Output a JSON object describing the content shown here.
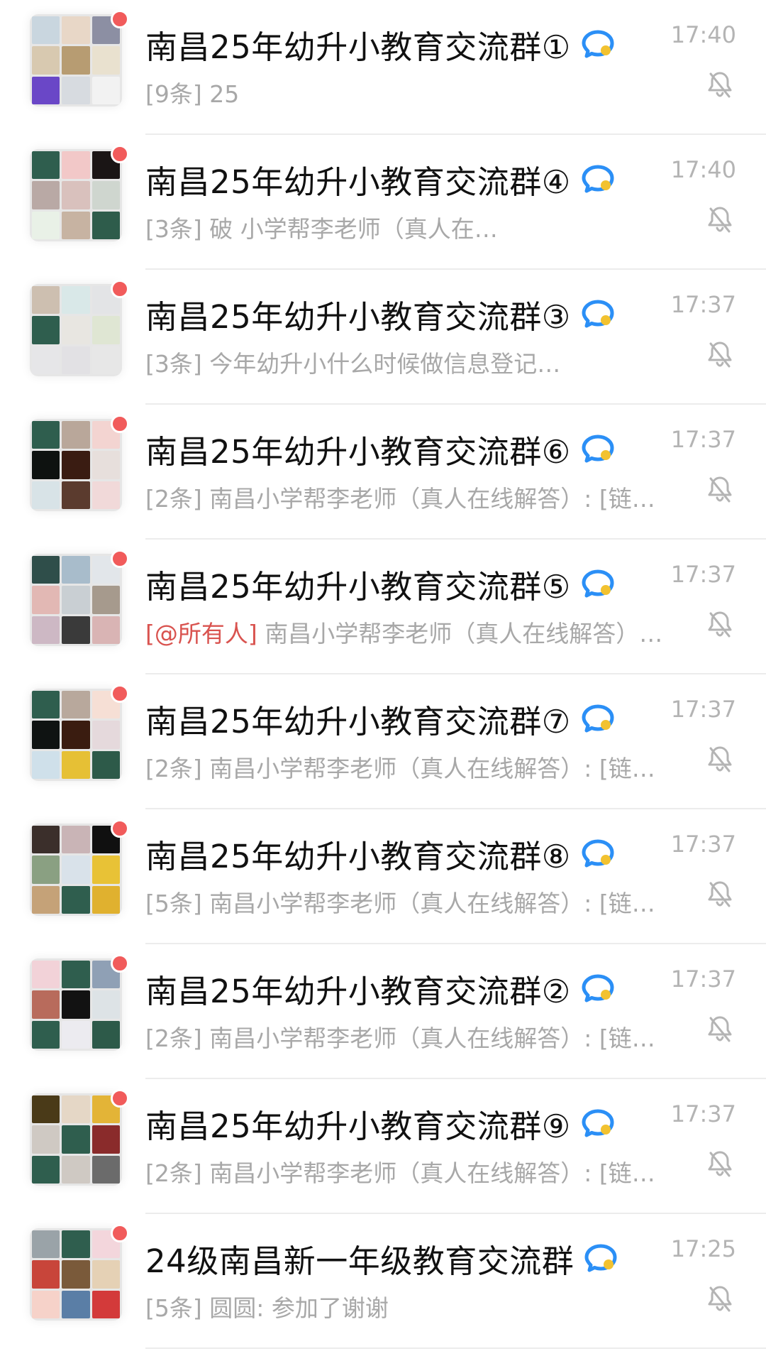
{
  "conversations": [
    {
      "title": "南昌25年幼升小教育交流群①",
      "preview_count": "[9条]",
      "preview_mention": "",
      "preview_text": "25",
      "time": "17:40",
      "muted": true,
      "unread_dot": true,
      "avatar_colors": [
        "#c9d6df",
        "#e8d7c7",
        "#8c8fa3",
        "#d8c9b0",
        "#b79c72",
        "#e9e1cf",
        "#6a47c7",
        "#d7dbe0",
        "#f2f2f2"
      ]
    },
    {
      "title": "南昌25年幼升小教育交流群④",
      "preview_count": "[3条]",
      "preview_mention": "",
      "preview_text": "破  小学帮李老师（真人在…",
      "time": "17:40",
      "muted": true,
      "unread_dot": true,
      "avatar_colors": [
        "#2f5e4e",
        "#f2c8c8",
        "#1a1515",
        "#b9a9a5",
        "#d9c1bd",
        "#cfd6cf",
        "#e9f1e7",
        "#c7b3a2",
        "#2e5c4b"
      ]
    },
    {
      "title": "南昌25年幼升小教育交流群③",
      "preview_count": "[3条]",
      "preview_mention": "",
      "preview_text": "今年幼升小什么时候做信息登记…",
      "time": "17:37",
      "muted": true,
      "unread_dot": true,
      "avatar_colors": [
        "#cdbfb0",
        "#d9e8e8",
        "#e3e4e6",
        "#2f5e4e",
        "#e8e6e1",
        "#dfe6d3",
        "#e6e6e8",
        "#e2e1e4",
        "#e7e7e7"
      ]
    },
    {
      "title": "南昌25年幼升小教育交流群⑥",
      "preview_count": "[2条]",
      "preview_mention": "",
      "preview_text": "南昌小学帮李老师（真人在线解答）: [链…",
      "time": "17:37",
      "muted": true,
      "unread_dot": true,
      "avatar_colors": [
        "#2f5e4e",
        "#b9a79a",
        "#f3d4d1",
        "#0e1210",
        "#3a1c12",
        "#e7dfdc",
        "#d8e3e7",
        "#5b3b2e",
        "#f1d9d9"
      ]
    },
    {
      "title": "南昌25年幼升小教育交流群⑤",
      "preview_count": "",
      "preview_mention": "[@所有人]",
      "preview_text": "南昌小学帮李老师（真人在线解答）…",
      "time": "17:37",
      "muted": true,
      "unread_dot": true,
      "avatar_colors": [
        "#2f4e4a",
        "#a8bccb",
        "#e2e6ea",
        "#e2b8b4",
        "#c9cfd3",
        "#a69a8d",
        "#cdb8c4",
        "#3a3a3a",
        "#d9b4b4"
      ]
    },
    {
      "title": "南昌25年幼升小教育交流群⑦",
      "preview_count": "[2条]",
      "preview_mention": "",
      "preview_text": "南昌小学帮李老师（真人在线解答）: [链…",
      "time": "17:37",
      "muted": true,
      "unread_dot": true,
      "avatar_colors": [
        "#2f5e4e",
        "#b8a89c",
        "#f6dfd5",
        "#0f1312",
        "#3a1c10",
        "#e5d9dc",
        "#cfe0ea",
        "#e6c035",
        "#2d5a49"
      ]
    },
    {
      "title": "南昌25年幼升小教育交流群⑧",
      "preview_count": "[5条]",
      "preview_mention": "",
      "preview_text": "南昌小学帮李老师（真人在线解答）: [链…",
      "time": "17:37",
      "muted": true,
      "unread_dot": true,
      "avatar_colors": [
        "#3b2f2b",
        "#c9b4b6",
        "#101010",
        "#8aa082",
        "#d9e2ea",
        "#e8c236",
        "#c5a278",
        "#2f5e4e",
        "#e0b12f"
      ]
    },
    {
      "title": "南昌25年幼升小教育交流群②",
      "preview_count": "[2条]",
      "preview_mention": "",
      "preview_text": "南昌小学帮李老师（真人在线解答）: [链…",
      "time": "17:37",
      "muted": true,
      "unread_dot": true,
      "avatar_colors": [
        "#f2d2d8",
        "#2f5e4e",
        "#8fa0b5",
        "#b86b5c",
        "#121212",
        "#dde3e6",
        "#2f5e4e",
        "#ecebf0",
        "#2d5a49"
      ]
    },
    {
      "title": "南昌25年幼升小教育交流群⑨",
      "preview_count": "[2条]",
      "preview_mention": "",
      "preview_text": "南昌小学帮李老师（真人在线解答）: [链…",
      "time": "17:37",
      "muted": true,
      "unread_dot": true,
      "avatar_colors": [
        "#4a3a18",
        "#e5d7c6",
        "#e3b437",
        "#cfc9c3",
        "#2f5e4e",
        "#8a2b2b",
        "#2f5e4e",
        "#cfc9c3",
        "#6b6b6b"
      ]
    },
    {
      "title": "24级南昌新一年级教育交流群",
      "preview_count": "[5条]",
      "preview_mention": "",
      "preview_text": "圆圆: 参加了谢谢",
      "time": "17:25",
      "muted": true,
      "unread_dot": true,
      "avatar_colors": [
        "#9aa3a8",
        "#2f5e4e",
        "#f3d6dc",
        "#c8453a",
        "#7a5a3a",
        "#e5d1b5",
        "#f6d2c9",
        "#5a7ea6",
        "#d33a3a"
      ]
    }
  ],
  "colors": {
    "accent_icon": "#2b8ff6",
    "accent_icon_secondary": "#f2c230",
    "unread_dot": "#f15b5b",
    "mention": "#d9534f"
  },
  "icons": {
    "group_chat_icon": "chat-bubble-icon",
    "mute_icon": "bell-muted-icon"
  }
}
